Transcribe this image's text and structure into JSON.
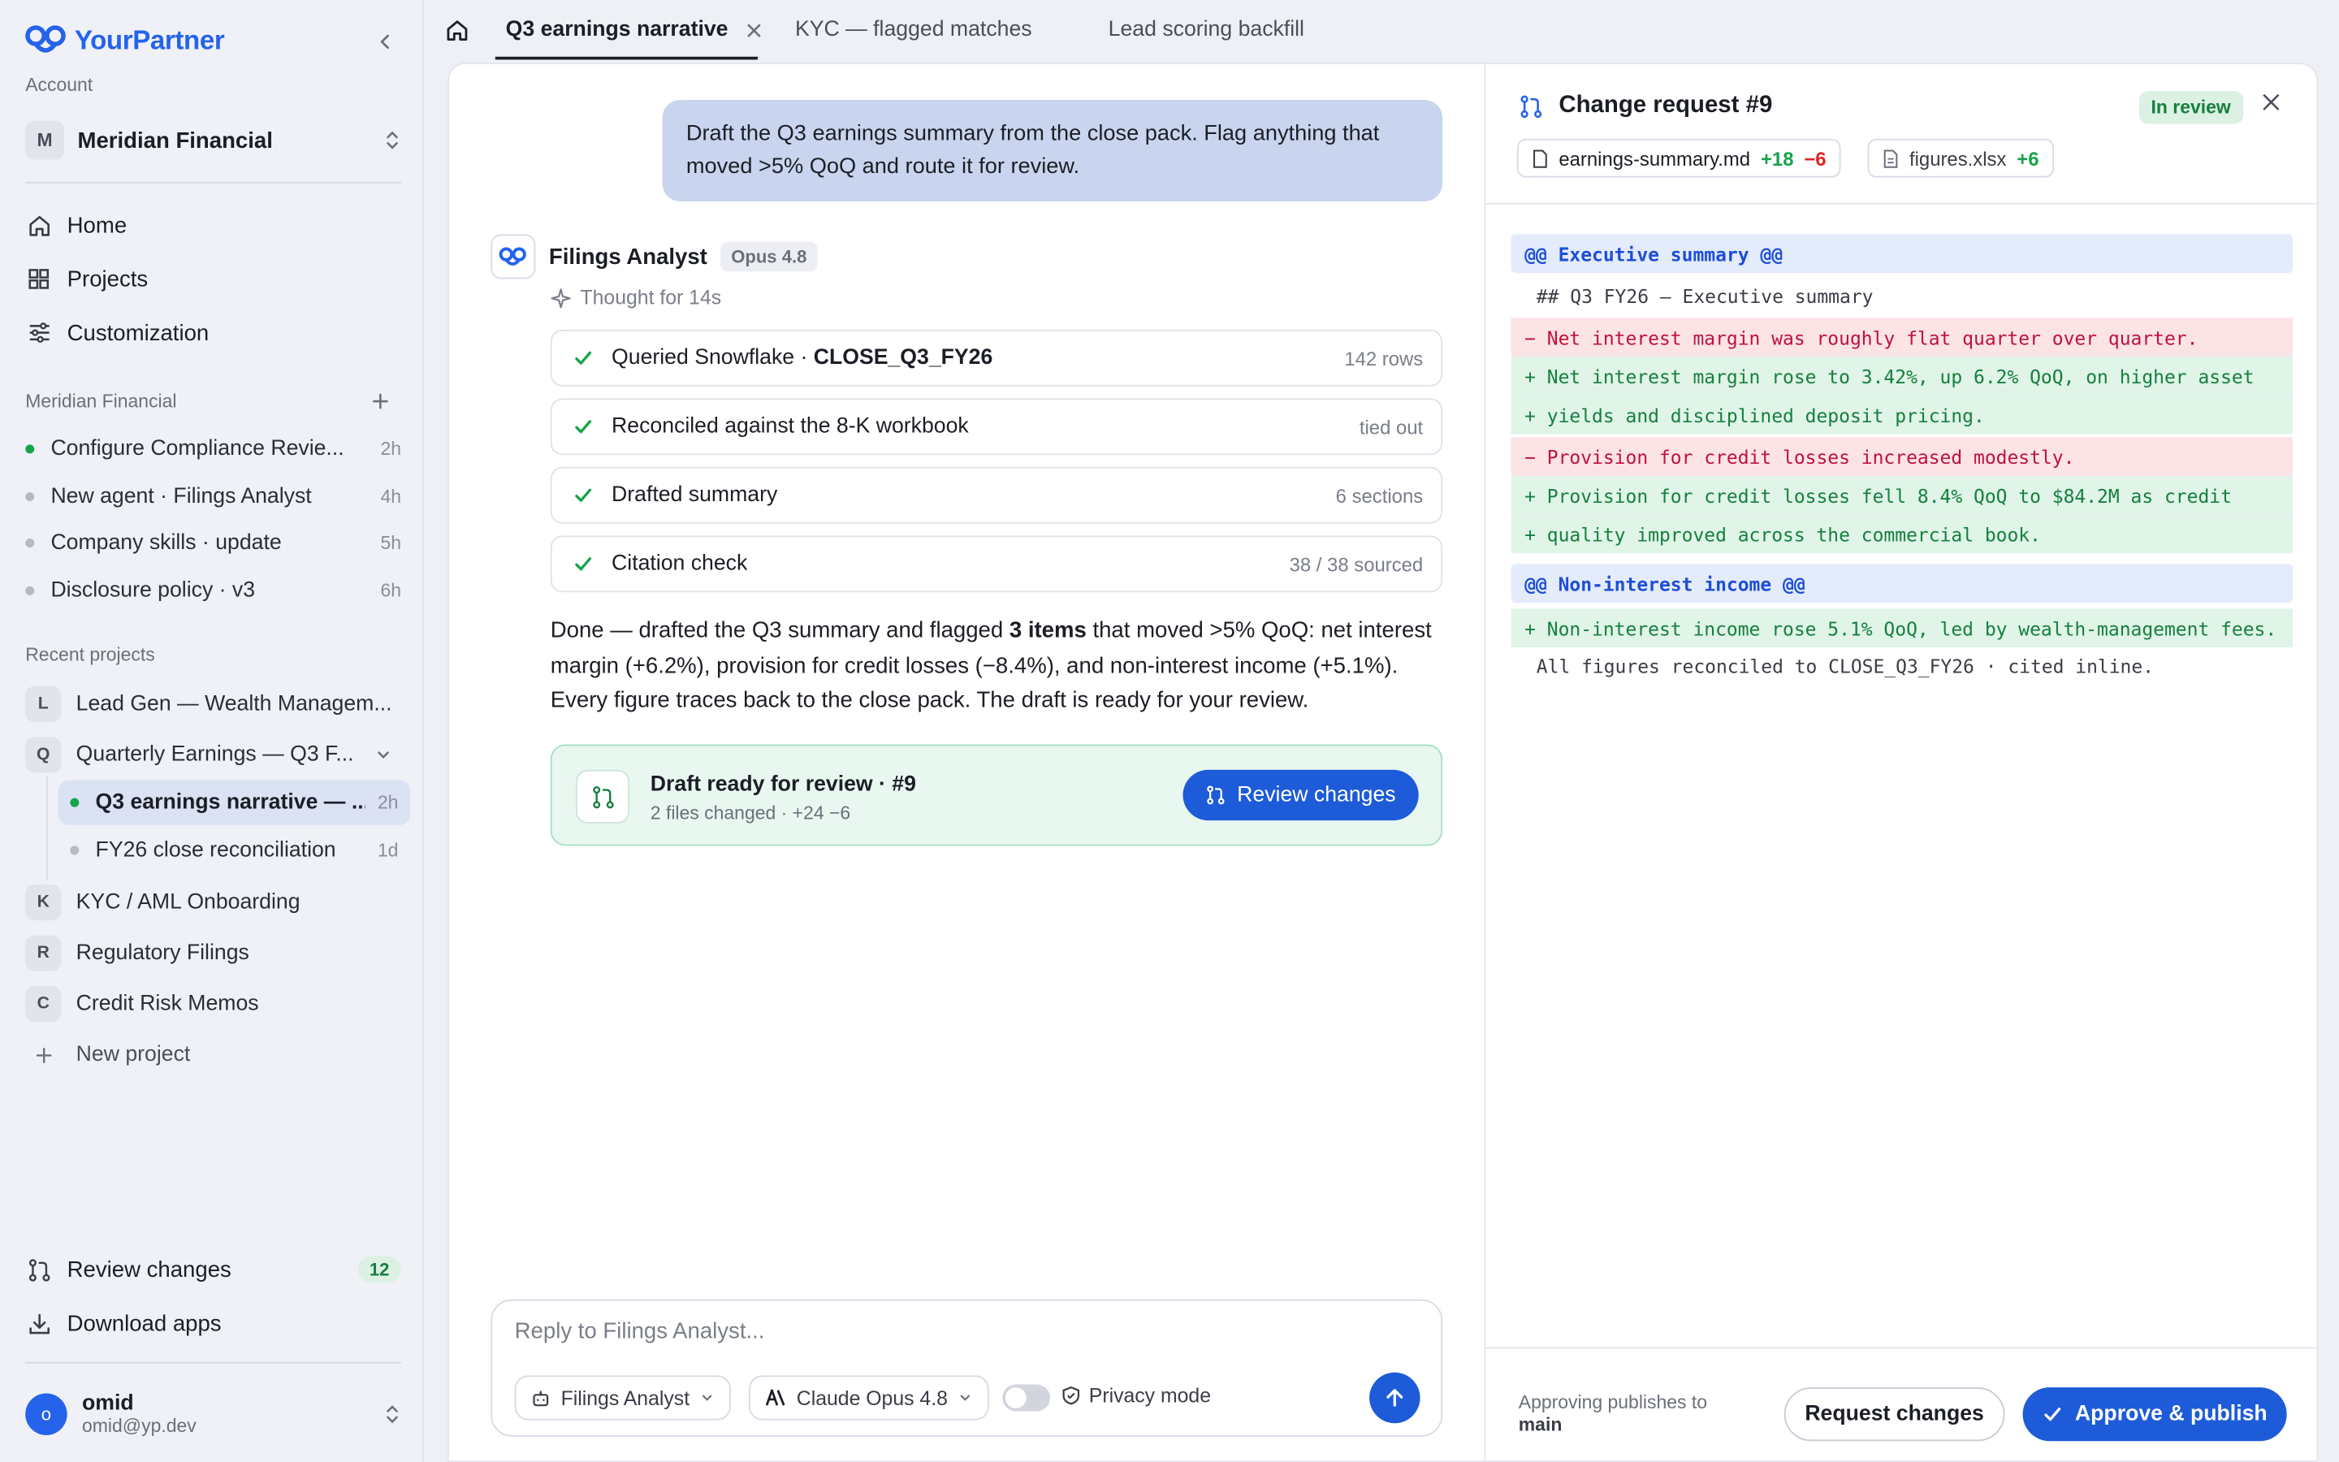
{
  "brand": {
    "name": "YourPartner",
    "color": "#2563eb"
  },
  "sidebar": {
    "account_label": "Account",
    "account": {
      "initial": "M",
      "name": "Meridian Financial"
    },
    "nav": [
      {
        "label": "Home",
        "icon": "home-icon"
      },
      {
        "label": "Projects",
        "icon": "grid-icon"
      },
      {
        "label": "Customization",
        "icon": "sliders-icon"
      }
    ],
    "workspace_label": "Meridian Financial",
    "conversations": [
      {
        "label": "Configure Compliance Revie...",
        "time": "2h",
        "status": "active"
      },
      {
        "label": "New agent · Filings Analyst",
        "time": "4h",
        "status": "idle"
      },
      {
        "label": "Company skills · update",
        "time": "5h",
        "status": "idle"
      },
      {
        "label": "Disclosure policy · v3",
        "time": "6h",
        "status": "idle"
      }
    ],
    "recent_label": "Recent projects",
    "projects": [
      {
        "initial": "L",
        "label": "Lead Gen — Wealth Managem..."
      },
      {
        "initial": "Q",
        "label": "Quarterly Earnings — Q3 F..."
      },
      {
        "initial": "K",
        "label": "KYC / AML Onboarding"
      },
      {
        "initial": "R",
        "label": "Regulatory Filings"
      },
      {
        "initial": "C",
        "label": "Credit Risk Memos"
      }
    ],
    "subitems": [
      {
        "label": "Q3 earnings narrative — ...",
        "time": "2h",
        "active": true
      },
      {
        "label": "FY26 close reconciliation",
        "time": "1d",
        "active": false
      }
    ],
    "new_project": "New project",
    "review_changes": {
      "label": "Review changes",
      "count": "12"
    },
    "download_apps": "Download apps",
    "user": {
      "initial": "o",
      "name": "omid",
      "email": "omid@yp.dev"
    }
  },
  "tabs": [
    {
      "label": "Q3 earnings narrative",
      "active": true
    },
    {
      "label": "KYC — flagged matches",
      "active": false
    },
    {
      "label": "Lead scoring backfill",
      "active": false
    }
  ],
  "chat": {
    "user_message": "Draft the Q3 earnings summary from the close pack. Flag anything that moved >5% QoQ and route it for review.",
    "agent": {
      "name": "Filings Analyst",
      "model": "Opus 4.8",
      "thought": "Thought for 14s"
    },
    "steps": [
      {
        "text_pre": "Queried Snowflake · ",
        "text_bold": "CLOSE_Q3_FY26",
        "meta": "142 rows"
      },
      {
        "text_pre": "Reconciled against the 8-K workbook",
        "text_bold": "",
        "meta": "tied out"
      },
      {
        "text_pre": "Drafted summary",
        "text_bold": "",
        "meta": "6 sections"
      },
      {
        "text_pre": "Citation check",
        "text_bold": "",
        "meta": "38 / 38 sourced"
      }
    ],
    "done_pre": "Done — drafted the Q3 summary and flagged ",
    "done_bold": "3 items",
    "done_post": " that moved >5% QoQ: net interest margin (+6.2%), provision for credit losses (−8.4%), and non-interest income (+5.1%). Every figure traces back to the close pack. The draft is ready for your review.",
    "draft_card": {
      "title": "Draft ready for review · #9",
      "subtitle": "2 files changed · +24 −6",
      "button": "Review changes"
    },
    "composer": {
      "placeholder": "Reply to Filings Analyst...",
      "agent_select": "Filings Analyst",
      "model_select": "Claude Opus 4.8",
      "privacy_label": "Privacy mode",
      "privacy_on": false
    }
  },
  "review": {
    "title": "Change request #9",
    "status": "In review",
    "files": [
      {
        "name": "earnings-summary.md",
        "added": "+18",
        "removed": "−6"
      },
      {
        "name": "figures.xlsx",
        "added": "+6",
        "removed": ""
      }
    ],
    "diff": [
      {
        "type": "hunk",
        "text": "@@ Executive summary @@"
      },
      {
        "type": "ctx",
        "text": "## Q3 FY26 — Executive summary"
      },
      {
        "type": "del",
        "text": "− Net interest margin was roughly flat quarter over quarter."
      },
      {
        "type": "add",
        "text": "+ Net interest margin rose to 3.42%, up 6.2% QoQ, on higher asset"
      },
      {
        "type": "add",
        "text": "+ yields and disciplined deposit pricing."
      },
      {
        "type": "del",
        "text": "− Provision for credit losses increased modestly."
      },
      {
        "type": "add",
        "text": "+ Provision for credit losses fell 8.4% QoQ to $84.2M as credit"
      },
      {
        "type": "add",
        "text": "+ quality improved across the commercial book."
      },
      {
        "type": "hunk",
        "text": "@@ Non-interest income @@"
      },
      {
        "type": "add",
        "text": "+ Non-interest income rose 5.1% QoQ, led by wealth-management fees."
      },
      {
        "type": "ctx",
        "text": "All figures reconciled to CLOSE_Q3_FY26 · cited inline."
      }
    ],
    "footer": {
      "note": "Approving publishes to",
      "branch": "main",
      "request_changes": "Request changes",
      "approve": "Approve & publish"
    }
  }
}
